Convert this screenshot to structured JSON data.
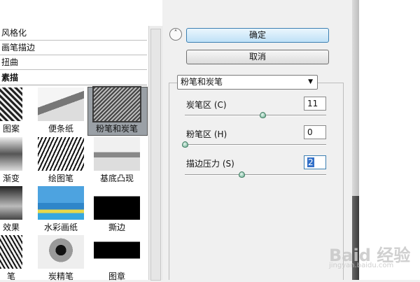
{
  "gallery": {
    "categories": [
      {
        "label": "风格化"
      },
      {
        "label": "画笔描边"
      },
      {
        "label": "扭曲"
      },
      {
        "label": "素描"
      }
    ],
    "thumbnails": [
      {
        "label": "图案"
      },
      {
        "label": "便条纸"
      },
      {
        "label": "粉笔和炭笔"
      },
      {
        "label": "渐变"
      },
      {
        "label": "绘图笔"
      },
      {
        "label": "基底凸现"
      },
      {
        "label": "效果"
      },
      {
        "label": "水彩画纸"
      },
      {
        "label": "撕边"
      },
      {
        "label": "笔"
      },
      {
        "label": "炭精笔"
      },
      {
        "label": "图章"
      }
    ],
    "selected_index": 2
  },
  "buttons": {
    "ok": "确定",
    "cancel": "取消"
  },
  "filter_select": {
    "value": "粉笔和炭笔"
  },
  "params": [
    {
      "label": "炭笔区 (C)",
      "value": "11",
      "level": 0.55
    },
    {
      "label": "粉笔区 (H)",
      "value": "0",
      "level": 0.0
    },
    {
      "label": "描边压力 (S)",
      "value": "2",
      "level": 0.4
    }
  ],
  "watermark": {
    "main": "Baid 经验",
    "sub": "jingyan.baidu.com"
  },
  "colors": {
    "accent": "#3c7fb1",
    "selection": "#3370c8",
    "slider": "#5fa889"
  }
}
